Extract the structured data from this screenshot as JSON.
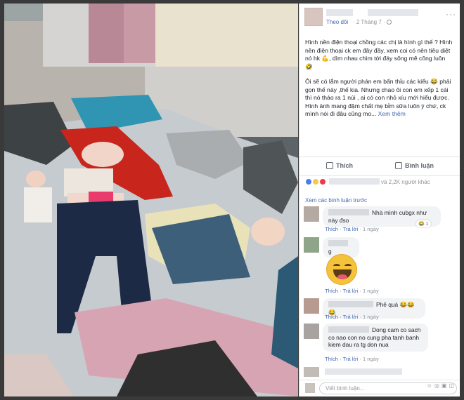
{
  "post": {
    "follow_label": "Theo dõi",
    "date": "· 2 Tháng 7 ·",
    "paragraph1": "Hình nền điện thoại chồng các chị là hình gì thế ? Hình nền điện thoại ck em đây đầy, xem coi có nên tiêu diệt nó hk 💪, dìm nhau chìm tới đáy sông mê công luôn 🤣",
    "paragraph2": "Ôi sẽ có lắm người phán em bẩn thỉu các kiểu 😂 phải gọn thế này ,thế kia. Nhưng chao ôi con em xếp 1 cái thì nó tháo ra 1 núi , ai có con nhỏ xíu mới hiểu được. Hình ảnh mang đậm chất mẹ bỉm sữa luôn ý chứ, ck mình nói đi đâu cũng mo...",
    "see_more": "Xem thêm"
  },
  "actions": {
    "like": "Thích",
    "comment": "Bình luận"
  },
  "reactions": {
    "count_text": "và 2,2K người khác"
  },
  "comments_header": "Xem các bình luận trước",
  "comments": [
    {
      "text": "Nhà mình cubgx như này đso",
      "like": "Thích",
      "reply": "Trả lời",
      "time": "· 1 ngày",
      "react_count": "1"
    },
    {
      "text": "g",
      "like": "Thích",
      "reply": "Trả lời",
      "time": "· 1 ngày"
    },
    {
      "text": "Phê quá 😂😂😂",
      "like": "Thích",
      "reply": "Trả lời",
      "time": "· 1 ngày"
    },
    {
      "text": "Dong cam co sach co nao con no cung pha tanh banh kiem dau ra tg don nua",
      "like": "Thích",
      "reply": "Trả lời",
      "time": "· 1 ngày"
    }
  ],
  "write_placeholder": "Viết bình luận...",
  "colors": {
    "link": "#4267b2",
    "muted": "#90949c",
    "bubble": "#f2f3f5"
  }
}
